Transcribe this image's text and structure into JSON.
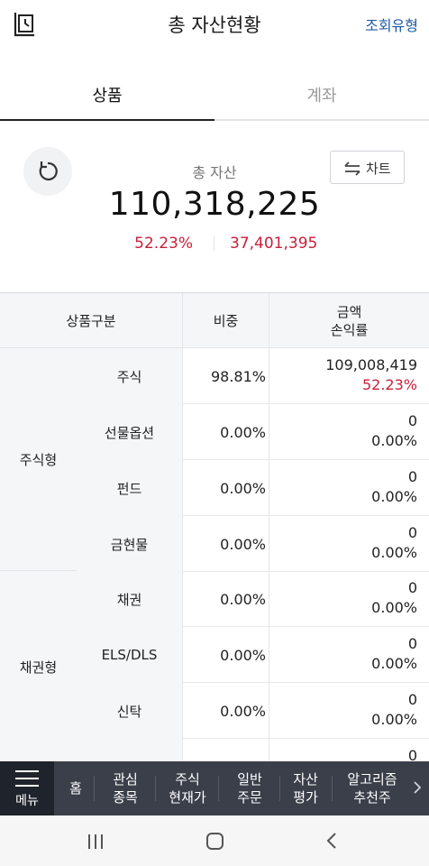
{
  "header": {
    "title": "총 자산현황",
    "query_label": "조회유형"
  },
  "tabs": [
    {
      "label": "상품",
      "active": true
    },
    {
      "label": "계좌",
      "active": false
    }
  ],
  "summary": {
    "total_label": "총 자산",
    "total_value": "110,318,225",
    "return_rate": "52.23%",
    "profit": "37,401,395",
    "chart_button_label": "차트"
  },
  "table": {
    "headers": {
      "category": "상품구분",
      "ratio": "비중",
      "amount_line1": "금액",
      "amount_line2": "손익률"
    },
    "groups": [
      {
        "label": "주식형"
      },
      {
        "label": "채권형"
      }
    ],
    "rows": [
      {
        "category": "주식",
        "ratio": "98.81%",
        "amount": "109,008,419",
        "pct": "52.23%"
      },
      {
        "category": "선물옵션",
        "ratio": "0.00%",
        "amount": "0",
        "pct": "0.00%"
      },
      {
        "category": "펀드",
        "ratio": "0.00%",
        "amount": "0",
        "pct": "0.00%"
      },
      {
        "category": "금현물",
        "ratio": "0.00%",
        "amount": "0",
        "pct": "0.00%"
      },
      {
        "category": "채권",
        "ratio": "0.00%",
        "amount": "0",
        "pct": "0.00%"
      },
      {
        "category": "ELS/DLS",
        "ratio": "0.00%",
        "amount": "0",
        "pct": "0.00%"
      },
      {
        "category": "신탁",
        "ratio": "0.00%",
        "amount": "0",
        "pct": "0.00%"
      },
      {
        "category": "",
        "ratio": "",
        "amount": "0",
        "pct": ""
      }
    ]
  },
  "bottom_nav": {
    "menu_label": "메뉴",
    "items": [
      {
        "line1": "홈",
        "line2": ""
      },
      {
        "line1": "관심",
        "line2": "종목"
      },
      {
        "line1": "주식",
        "line2": "현재가"
      },
      {
        "line1": "일반",
        "line2": "주문"
      },
      {
        "line1": "자산",
        "line2": "평가"
      },
      {
        "line1": "알고리즘",
        "line2": "추천주"
      }
    ]
  },
  "colors": {
    "accent_red": "#c8203b",
    "link_blue": "#1f5aa6",
    "nav_bg": "#3a3f4a",
    "menu_bg": "#1f232b"
  }
}
